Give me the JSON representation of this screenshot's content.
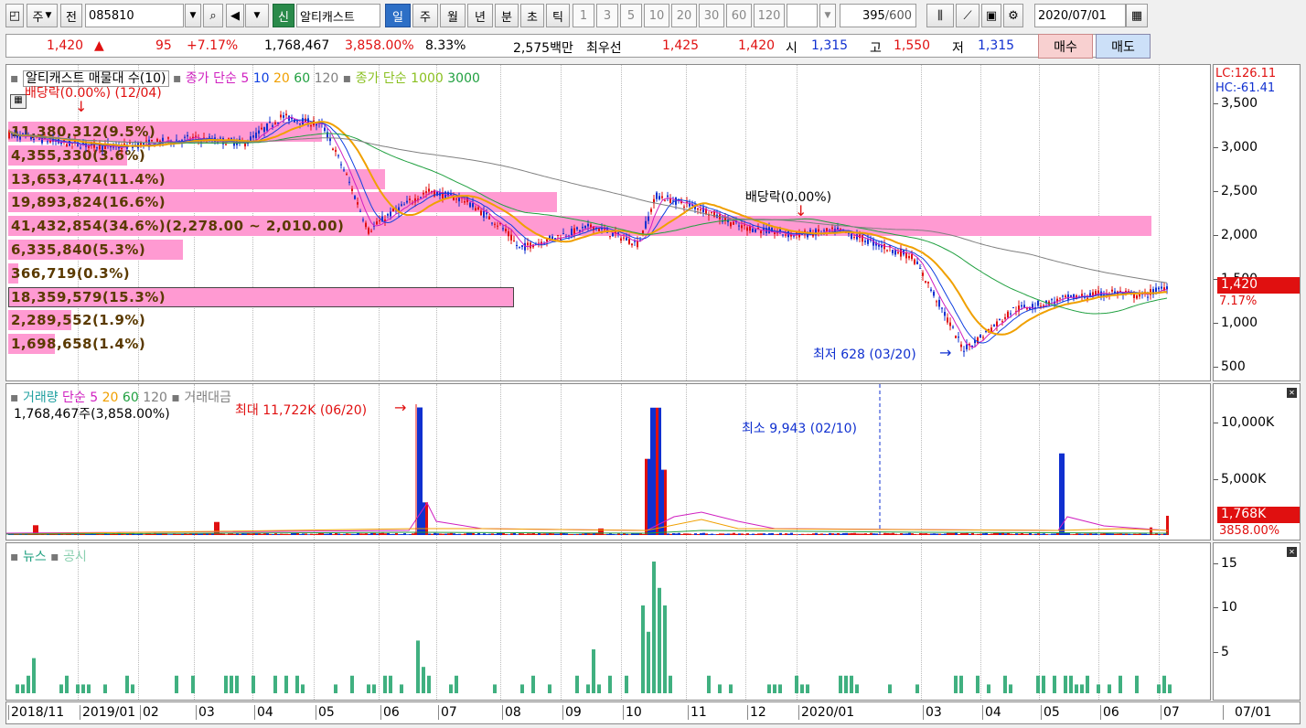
{
  "toolbar": {
    "market_label": "주",
    "prev_label": "전",
    "stock_code": "085810",
    "new_badge": "신",
    "stock_name": "알티캐스트",
    "periods": [
      "일",
      "주",
      "월",
      "년",
      "분",
      "초",
      "틱"
    ],
    "selected_period": "일",
    "intervals": [
      "1",
      "3",
      "5",
      "10",
      "20",
      "30",
      "60",
      "120"
    ],
    "count_value": "395",
    "count_total": "/600",
    "date": "2020/07/01"
  },
  "info": {
    "price": "1,420",
    "change_arrow": "▲",
    "change": "95",
    "change_pct": "+7.17%",
    "volume": "1,768,467",
    "volume_ratio": "3,858.00%",
    "turnover": "8.33%",
    "amount": "2,575백만",
    "best_label": "최우선",
    "best_ask": "1,425",
    "best_bid": "1,420",
    "open_label": "시",
    "open": "1,315",
    "high_label": "고",
    "high": "1,550",
    "low_label": "저",
    "low": "1,315",
    "buy_label": "매수",
    "sell_label": "매도"
  },
  "price_panel": {
    "legend_stock": "알티캐스트 매물대 수(10)",
    "legend_ma_title": "종가 단순",
    "legend_ma": [
      "5",
      "10",
      "20",
      "60",
      "120"
    ],
    "legend_ma2_title": "종가 단순",
    "legend_ma2": [
      "1000",
      "3000"
    ],
    "dividend_top": "배당락(0.00%) (12/04)",
    "dividend_mid": "배당락(0.00%)",
    "low_annotation": "최저 628 (03/20)",
    "lc_label": "LC:126.11",
    "hc_label": "HC:-61.41",
    "price_ticks": [
      "3,500",
      "3,000",
      "2,500",
      "2,000",
      "1,500",
      "1,000",
      "500"
    ],
    "current_price_tag": "1,420",
    "current_pct_tag": "7.17%",
    "volume_profile": [
      {
        "text": "11,380,312(9.5%)",
        "pct": 9.5
      },
      {
        "text": "4,355,330(3.6%)",
        "pct": 3.6
      },
      {
        "text": "13,653,474(11.4%)",
        "pct": 11.4
      },
      {
        "text": "19,893,824(16.6%)",
        "pct": 16.6
      },
      {
        "text": "41,432,854(34.6%)(2,278.00 ~ 2,010.00)",
        "pct": 34.6
      },
      {
        "text": "6,335,840(5.3%)",
        "pct": 5.3
      },
      {
        "text": "366,719(0.3%)",
        "pct": 0.3
      },
      {
        "text": "18,359,579(15.3%)",
        "pct": 15.3
      },
      {
        "text": "2,289,552(1.9%)",
        "pct": 1.9
      },
      {
        "text": "1,698,658(1.4%)",
        "pct": 1.4
      }
    ]
  },
  "volume_panel": {
    "legend_title": "거래량",
    "legend_ma_title": "단순",
    "legend_ma": [
      "5",
      "20",
      "60",
      "120"
    ],
    "legend_amount": "거래대금",
    "current_volume": "1,768,467주(3,858.00%)",
    "max_annotation": "최대 11,722K (06/20)",
    "min_annotation": "최소 9,943 (02/10)",
    "ticks": [
      "10,000K",
      "5,000K"
    ],
    "current_tag": "1,768K",
    "current_pct_tag": "3858.00%"
  },
  "news_panel": {
    "legend_news": "뉴스",
    "legend_disclosure": "공시",
    "ticks": [
      "15",
      "10",
      "5"
    ]
  },
  "x_axis": {
    "labels": [
      "2018/11",
      "2019/01",
      "02",
      "03",
      "04",
      "05",
      "06",
      "07",
      "08",
      "09",
      "10",
      "11",
      "12",
      "2020/01",
      "03",
      "04",
      "05",
      "06",
      "07"
    ],
    "right_label": "07/01"
  },
  "colors": {
    "up": "#e01010",
    "down": "#1030d0",
    "ma5": "#d020c0",
    "ma10": "#1040e0",
    "ma20": "#f0a000",
    "ma60": "#20a040",
    "ma120": "#808080",
    "profile": "#ff9ad2",
    "news": "#40b080"
  }
}
